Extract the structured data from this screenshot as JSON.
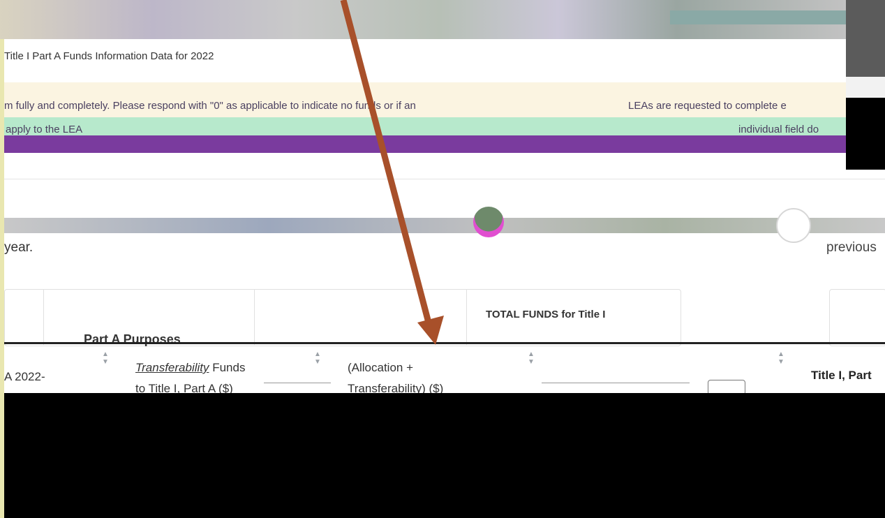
{
  "header": {
    "page_title": "Title I Part A Funds Information Data for 2022"
  },
  "notice": {
    "text_left": "m fully and completely. Please respond with \"0\" as applicable to indicate no funds or if an",
    "text_right": "LEAs are requested to complete e"
  },
  "info_bar": {
    "text_left": "apply to the LEA",
    "text_right": "individual field do"
  },
  "section": {
    "year_text": "year.",
    "previous_text": "previous"
  },
  "table": {
    "columns": {
      "year_prefix": "A 2022-",
      "part_a_purposes": "Part A Purposes",
      "transferability_em": "Transferability",
      "transferability_rest": " Funds",
      "transferability_line2": "to Title I, Part A ($)",
      "allocation_line1": "(Allocation +",
      "allocation_line2": "Transferability) ($)",
      "totals_label": "TOTAL FUNDS for Title I",
      "title_i_part": "Title I, Part"
    }
  },
  "colors": {
    "notice_bg": "#fbf4e1",
    "info_bg": "#b7e9cc",
    "purple_bar": "#7a3b9e",
    "arrow": "#a8502a"
  },
  "icons": [
    "sort-icon",
    "avatar-circle",
    "arrow-annotation"
  ]
}
